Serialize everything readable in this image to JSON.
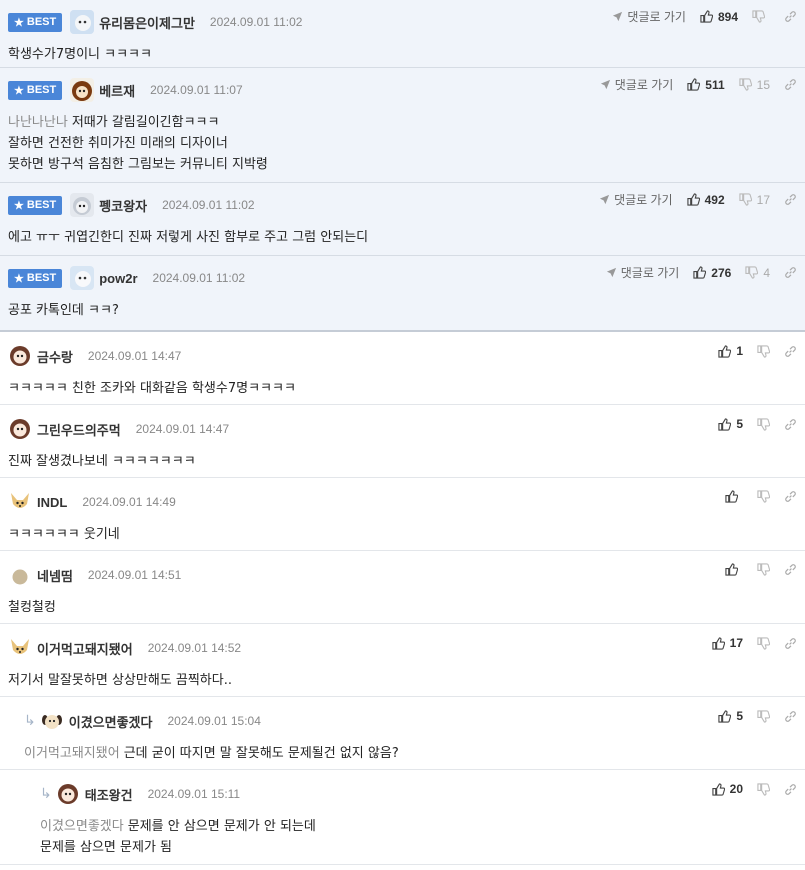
{
  "labels": {
    "best": "BEST",
    "go_to_reply": "댓글로 가기"
  },
  "best_comments": [
    {
      "nick": "유리몸은이제그만",
      "date": "2024.09.01 11:02",
      "up": "894",
      "down": "",
      "lines": [
        "학생수가7명이니 ㅋㅋㅋㅋ"
      ],
      "ref": ""
    },
    {
      "nick": "베르재",
      "date": "2024.09.01 11:07",
      "up": "511",
      "down": "15",
      "ref": "나난나난나",
      "lines": [
        "저때가 갈림길이긴함ㅋㅋㅋ",
        "잘하면 건전한 취미가진 미래의 디자이너",
        "못하면 방구석 음침한 그림보는 커뮤니티 지박령"
      ]
    },
    {
      "nick": "펭코왕자",
      "date": "2024.09.01 11:02",
      "up": "492",
      "down": "17",
      "lines": [
        "에고 ㅠㅜ 귀엽긴한디 진짜 저렇게 사진 함부로 주고 그럼 안되는디"
      ],
      "ref": ""
    },
    {
      "nick": "pow2r",
      "date": "2024.09.01 11:02",
      "up": "276",
      "down": "4",
      "lines": [
        "공포 카톡인데 ㅋㅋ?"
      ],
      "ref": ""
    }
  ],
  "comments": [
    {
      "nick": "금수랑",
      "date": "2024.09.01 14:47",
      "up": "1",
      "lines": [
        "ㅋㅋㅋㅋㅋ 친한 조카와 대화같음 학생수7명ㅋㅋㅋㅋ"
      ]
    },
    {
      "nick": "그린우드의주먹",
      "date": "2024.09.01 14:47",
      "up": "5",
      "lines": [
        "진짜 잘생겼나보네 ㅋㅋㅋㅋㅋㅋㅋ"
      ]
    },
    {
      "nick": "INDL",
      "date": "2024.09.01 14:49",
      "up": "",
      "lines": [
        "ㅋㅋㅋㅋㅋㅋ 웃기네"
      ]
    },
    {
      "nick": "네넴띰",
      "date": "2024.09.01 14:51",
      "up": "",
      "lines": [
        "철컹철컹"
      ]
    },
    {
      "nick": "이거먹고돼지됐어",
      "date": "2024.09.01 14:52",
      "up": "17",
      "lines": [
        "저기서 말잘못하면 상상만해도 끔찍하다.."
      ]
    }
  ],
  "replies": [
    {
      "nick": "이겼으면좋겠다",
      "date": "2024.09.01 15:04",
      "up": "5",
      "ref": "이거먹고돼지됐어",
      "lines": [
        "근데 굳이 따지면 말 잘못해도 문제될건 없지 않음?"
      ]
    },
    {
      "nick": "태조왕건",
      "date": "2024.09.01 15:11",
      "up": "20",
      "ref": "이겼으면좋겠다",
      "lines": [
        "문제를 안 삼으면 문제가 안 되는데",
        "문제를 삼으면 문제가 됨"
      ]
    }
  ],
  "icons": {
    "go": "send-arrow-icon",
    "up": "thumbs-up-icon",
    "down": "thumbs-down-icon",
    "link": "link-icon",
    "reply": "reply-arrow-icon",
    "badge": "star-icon"
  },
  "colors": {
    "best_bg": "#f0f4fa",
    "badge": "#4a86d8",
    "ref_text": "#8a8a8a"
  }
}
